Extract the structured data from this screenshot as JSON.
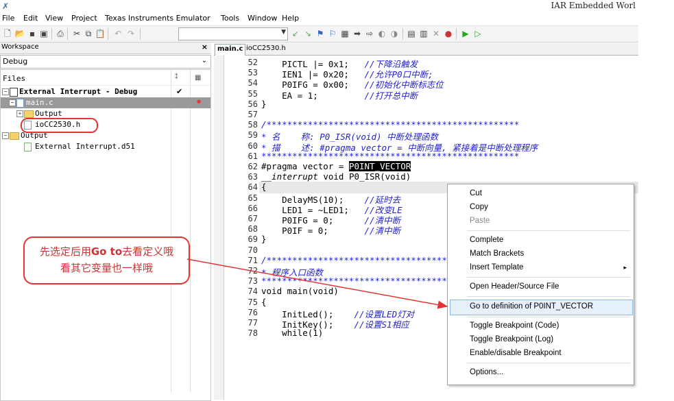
{
  "window": {
    "title": "IAR Embedded Worl",
    "app_icon": "iar-icon"
  },
  "menu": [
    "File",
    "Edit",
    "View",
    "Project",
    "Texas Instruments Emulator",
    "Tools",
    "Window",
    "Help"
  ],
  "toolbar": {
    "icons": [
      "new-file-icon",
      "open-icon",
      "save-icon",
      "save-all-icon",
      "print-icon",
      "cut-icon",
      "copy-icon",
      "paste-icon",
      "undo-icon",
      "redo-icon",
      "find-next-icon",
      "find-prev-icon",
      "bookmark-icon",
      "toggle-bookmark-icon",
      "goto-icon",
      "next-icon",
      "back-icon",
      "navigate-icon",
      "navigate2-icon",
      "compile-icon",
      "make-icon",
      "stop-icon",
      "breakpoint-icon",
      "debug-icon",
      "debug-without-download-icon"
    ],
    "combo_value": ""
  },
  "workspace": {
    "title": "Workspace",
    "close": "×",
    "config": "Debug",
    "files_header": "Files",
    "tree": [
      {
        "label": "External Interrupt - Debug",
        "check": "✔"
      },
      {
        "label": "main.c"
      },
      {
        "label": "Output"
      },
      {
        "label": "ioCC2530.h"
      },
      {
        "label": "Output"
      },
      {
        "label": "External Interrupt.d51"
      }
    ]
  },
  "editor": {
    "tabs": [
      "main.c",
      "ioCC2530.h"
    ],
    "lines": [
      {
        "n": "52",
        "code": "    PICTL |= 0x1;",
        "comment": "//下降沿触发"
      },
      {
        "n": "53",
        "code": "    IEN1 |= 0x20;",
        "comment": "//允许P0口中断;"
      },
      {
        "n": "54",
        "code": "    P0IFG = 0x00;",
        "comment": "//初始化中断标志位"
      },
      {
        "n": "55",
        "code": "    EA = 1;",
        "comment": "//打开总中断"
      },
      {
        "n": "56",
        "code": "}",
        "comment": ""
      },
      {
        "n": "57",
        "code": "",
        "comment": ""
      },
      {
        "n": "58",
        "code": "",
        "comment": "/*************************************************"
      },
      {
        "n": "59",
        "code": "",
        "comment": "* 名    称: P0_ISR(void) 中断处理函数"
      },
      {
        "n": "60",
        "code": "",
        "comment": "* 描    述: #pragma vector = 中断向量, 紧接着是中断处理程序"
      },
      {
        "n": "61",
        "code": "",
        "comment": "**************************************************"
      },
      {
        "n": "62",
        "pre": "#pragma vector = ",
        "sel": "P0INT_VECTOR"
      },
      {
        "n": "63",
        "pre": "__interrupt",
        "post": " void P0_ISR(void)"
      },
      {
        "n": "64",
        "code": "{",
        "comment": ""
      },
      {
        "n": "65",
        "code": "    DelayMS(10);",
        "comment": "//延时去"
      },
      {
        "n": "66",
        "code": "    LED1 = ~LED1;",
        "comment": "//改变LE"
      },
      {
        "n": "67",
        "code": "    P0IFG = 0;",
        "comment": "//清中断"
      },
      {
        "n": "68",
        "code": "    P0IF = 0;",
        "comment": "//清中断"
      },
      {
        "n": "69",
        "code": "}",
        "comment": ""
      },
      {
        "n": "70",
        "code": "",
        "comment": ""
      },
      {
        "n": "71",
        "code": "",
        "comment": "/*************************************************"
      },
      {
        "n": "72",
        "code": "",
        "comment": "* 程序入口函数"
      },
      {
        "n": "73",
        "code": "",
        "comment": "**************************************************"
      },
      {
        "n": "74",
        "code": "void main(void)",
        "comment": ""
      },
      {
        "n": "75",
        "code": "{",
        "comment": ""
      },
      {
        "n": "76",
        "code": "    InitLed();",
        "comment": "//设置LED灯对"
      },
      {
        "n": "77",
        "code": "    InitKey();",
        "comment": "//设置S1相应"
      },
      {
        "n": "78",
        "code": "    while(1)",
        "comment": ""
      }
    ]
  },
  "context_menu": {
    "items": [
      {
        "label": "Cut",
        "enabled": true
      },
      {
        "label": "Copy",
        "enabled": true
      },
      {
        "label": "Paste",
        "enabled": false
      },
      {
        "label": "Complete",
        "enabled": true
      },
      {
        "label": "Match Brackets",
        "enabled": true
      },
      {
        "label": "Insert Template",
        "enabled": true,
        "submenu": "▸"
      },
      {
        "label": "Open Header/Source File",
        "enabled": true
      },
      {
        "label": "Go to definition of P0INT_VECTOR",
        "enabled": true,
        "highlighted": true
      },
      {
        "label": "Toggle Breakpoint (Code)",
        "enabled": true
      },
      {
        "label": "Toggle Breakpoint (Log)",
        "enabled": true
      },
      {
        "label": "Enable/disable Breakpoint",
        "enabled": true
      },
      {
        "label": "Options...",
        "enabled": true
      }
    ]
  },
  "annotation": {
    "line1_pre": "先选定后用",
    "line1_bold": "Go to",
    "line1_post": "去看定义哦",
    "line2": "看其它变量也一样哦",
    "color": "#e53333"
  }
}
